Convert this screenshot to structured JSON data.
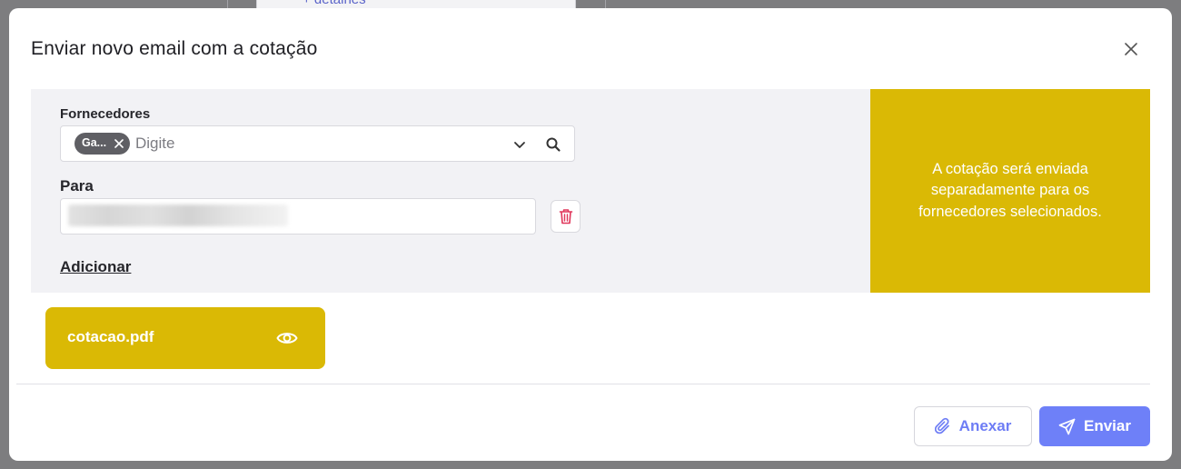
{
  "background": {
    "partial_link": "+ detalhes"
  },
  "modal": {
    "title": "Enviar novo email com a cotação",
    "close_icon": "close-icon"
  },
  "form": {
    "suppliers_label": "Fornecedores",
    "supplier_chip": "Ga...",
    "supplier_placeholder": "Digite",
    "to_label": "Para",
    "to_value_obscured": true,
    "add_link": "Adicionar"
  },
  "info": {
    "message": "A cotação será enviada separadamente para os fornecedores selecionados."
  },
  "attachment": {
    "file_name": "cotacao.pdf",
    "view_icon": "eye-icon"
  },
  "footer": {
    "attach_label": "Anexar",
    "send_label": "Enviar"
  },
  "colors": {
    "accent_yellow": "#dab905",
    "primary_blue": "#6e80f8",
    "danger_red": "#e0365a",
    "overlay": "#7d7d7f"
  }
}
